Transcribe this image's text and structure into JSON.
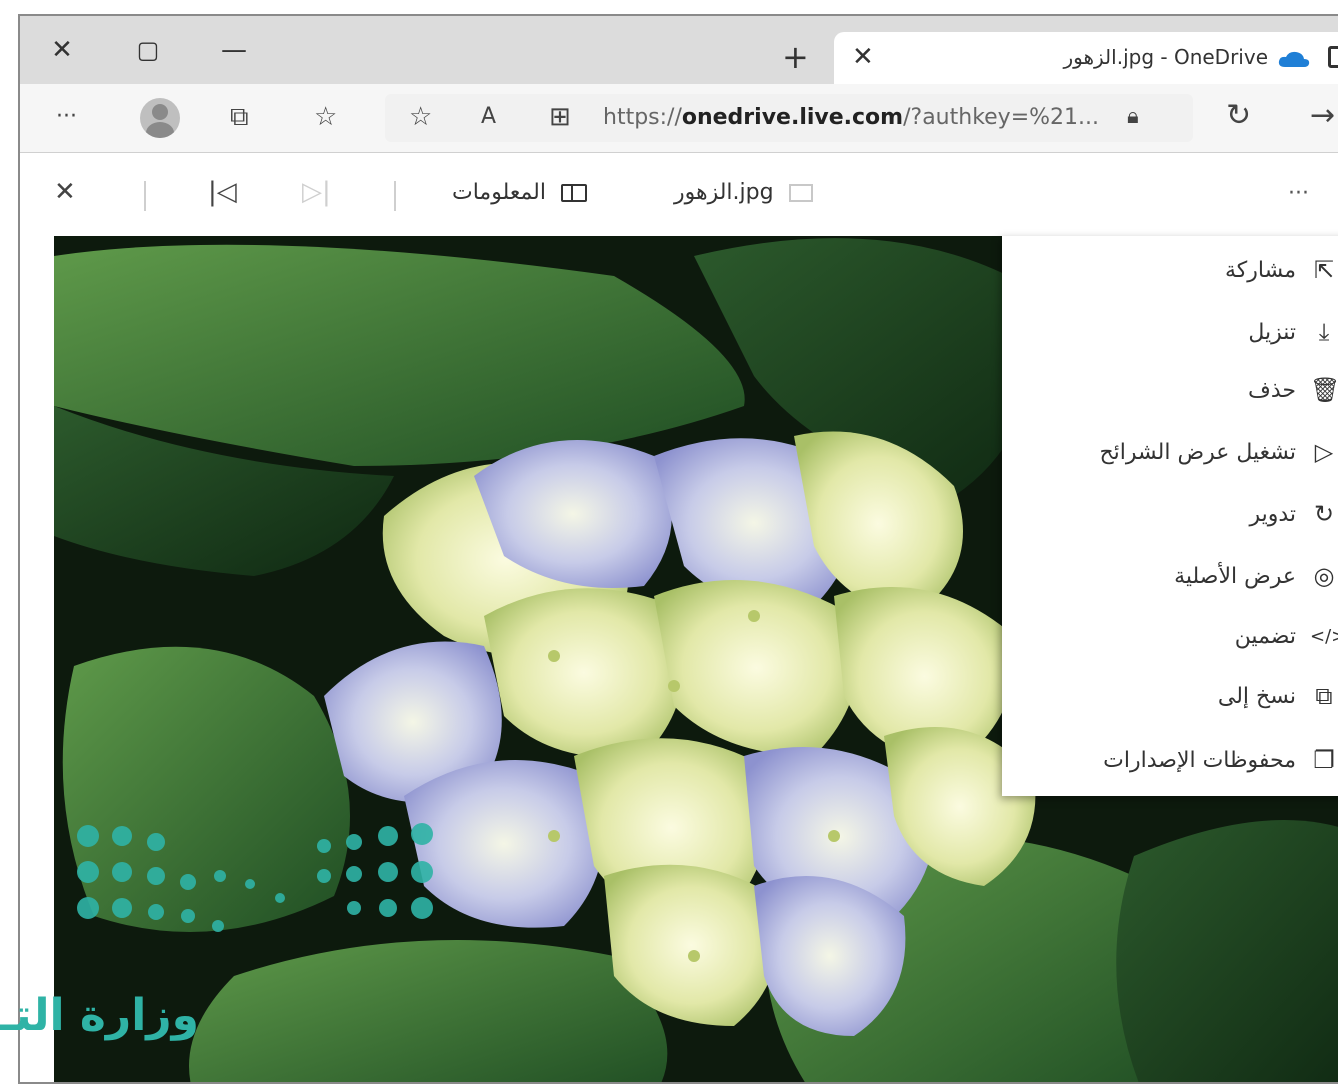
{
  "browser": {
    "tab_title": "الزهور.jpg - OneDrive",
    "url_prefix": "https://",
    "url_domain": "onedrive.live.com",
    "url_suffix": "/?authkey=%21...",
    "window_controls": {
      "close": "✕",
      "maximize": "▢",
      "minimize": "—"
    },
    "new_tab": "+",
    "icons": [
      "more-icon",
      "profile-icon",
      "collections-icon",
      "favorites-icon",
      "add-favorite-icon",
      "read-aloud-icon",
      "app-available-icon",
      "lock-icon",
      "refresh-icon",
      "forward-icon"
    ]
  },
  "viewer_toolbar": {
    "close": "✕",
    "prev": "|◁",
    "next": "▷|",
    "info_label": "المعلومات",
    "file_name": "الزهور.jpg",
    "more": "···"
  },
  "menu": {
    "items": [
      {
        "label": "مشاركة",
        "icon": "share-icon"
      },
      {
        "label": "تنزيل",
        "icon": "download-icon"
      },
      {
        "label": "حذف",
        "icon": "trash-icon"
      },
      {
        "label": "تشغيل عرض الشرائح",
        "icon": "play-icon"
      },
      {
        "label": "تدوير",
        "icon": "rotate-icon"
      },
      {
        "label": "عرض الأصلية",
        "icon": "view-original-icon"
      },
      {
        "label": "تضمين",
        "icon": "embed-icon"
      },
      {
        "label": "نسخ إلى",
        "icon": "copy-icon"
      },
      {
        "label": "محفوظات الإصدارات",
        "icon": "version-history-icon"
      }
    ]
  },
  "watermark": {
    "text": "وزارة التـ"
  },
  "colors": {
    "watermark": "#2fb3a6",
    "cloud": "#1f7fd6"
  }
}
